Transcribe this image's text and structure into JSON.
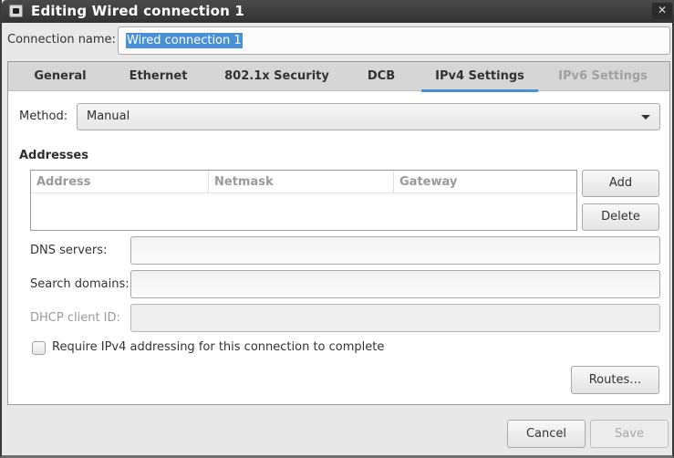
{
  "window": {
    "title": "Editing Wired connection 1",
    "icon": "network-wired-icon",
    "close_label": "✕"
  },
  "connection_name": {
    "label": "Connection name:",
    "value": "Wired connection 1",
    "selected": true
  },
  "tabs": [
    {
      "label": "General",
      "state": "normal"
    },
    {
      "label": "Ethernet",
      "state": "normal"
    },
    {
      "label": "802.1x Security",
      "state": "normal"
    },
    {
      "label": "DCB",
      "state": "normal"
    },
    {
      "label": "IPv4 Settings",
      "state": "active"
    },
    {
      "label": "IPv6 Settings",
      "state": "disabled"
    }
  ],
  "ipv4": {
    "method": {
      "label": "Method:",
      "value": "Manual"
    },
    "addresses": {
      "heading": "Addresses",
      "columns": [
        "Address",
        "Netmask",
        "Gateway"
      ],
      "rows": []
    },
    "add_label": "Add",
    "delete_label": "Delete",
    "dns": {
      "label": "DNS servers:",
      "value": ""
    },
    "search_domains": {
      "label": "Search domains:",
      "value": ""
    },
    "dhcp_client_id": {
      "label": "DHCP client ID:",
      "value": "",
      "disabled": true
    },
    "require_ipv4": {
      "label": "Require IPv4 addressing for this connection to complete",
      "checked": false
    },
    "routes_label": "Routes…"
  },
  "footer": {
    "cancel_label": "Cancel",
    "save_label": "Save",
    "save_disabled": true
  },
  "colors": {
    "accent": "#4a90d9",
    "titlebar": "#3a3a3a"
  }
}
